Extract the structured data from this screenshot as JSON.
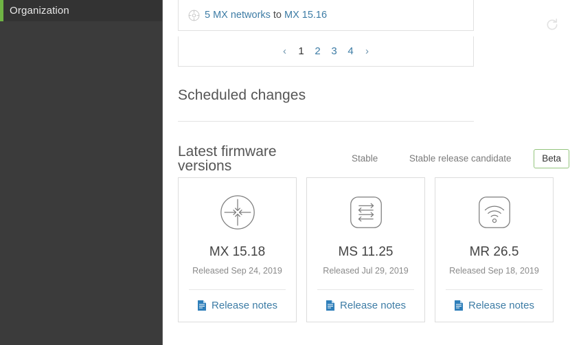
{
  "sidebar": {
    "active_item": {
      "label": "Organization",
      "icon": "none"
    },
    "accent_color": "#6fb444",
    "background_color": "#3b3b3b"
  },
  "upgrades_panel": {
    "rows": [
      {
        "icon": "mx-appliance-icon",
        "count_link": "5 MX networks",
        "connector": "to",
        "version_link": "MX 15.16"
      }
    ],
    "refresh_icon": "refresh-icon"
  },
  "pagination": {
    "prev_label": "‹",
    "next_label": "›",
    "pages": [
      "1",
      "2",
      "3",
      "4"
    ],
    "current_page": "1"
  },
  "scheduled_changes": {
    "title": "Scheduled changes"
  },
  "firmware": {
    "title": "Latest firmware versions",
    "tabs": [
      {
        "label": "Stable",
        "active": false
      },
      {
        "label": "Stable release candidate",
        "active": false
      },
      {
        "label": "Beta",
        "active": true
      }
    ],
    "active_tab_border_color": "#93c47d",
    "link_color": "#3d7ca5",
    "cards": [
      {
        "icon": "mx-security-appliance-icon",
        "title": "MX 15.18",
        "released": "Released Sep 24, 2019",
        "link_label": "Release notes",
        "link_icon": "document-icon"
      },
      {
        "icon": "ms-switch-icon",
        "title": "MS 11.25",
        "released": "Released Jul 29, 2019",
        "link_label": "Release notes",
        "link_icon": "document-icon"
      },
      {
        "icon": "mr-wireless-icon",
        "title": "MR 26.5",
        "released": "Released Sep 18, 2019",
        "link_label": "Release notes",
        "link_icon": "document-icon"
      }
    ]
  }
}
